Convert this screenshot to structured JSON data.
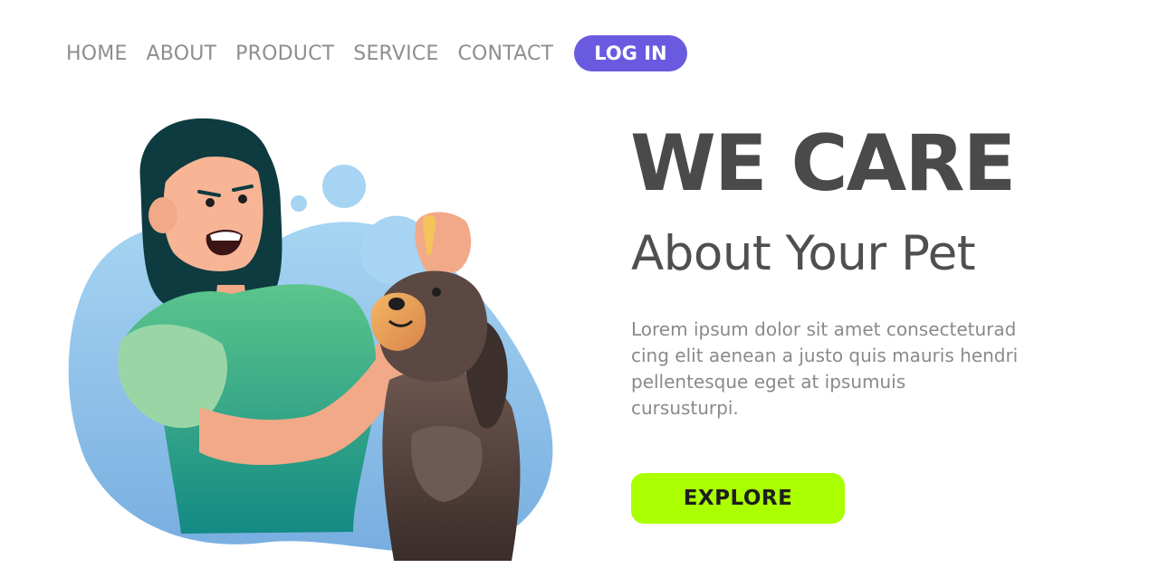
{
  "nav": {
    "items": [
      "HOME",
      "ABOUT",
      "PRODUCT",
      "SERVICE",
      "CONTACT"
    ],
    "login_label": "LOG IN"
  },
  "hero": {
    "headline": "WE CARE",
    "subheadline": "About Your Pet",
    "body_lines": [
      "Lorem ipsum dolor sit amet consecteturad",
      "cing elit aenean a justo quis mauris hendri",
      "pellentesque eget at ipsumuis",
      "cursusturpi."
    ],
    "cta_label": "EXPLORE"
  },
  "colors": {
    "login_bg": "#6a5ae0",
    "cta_bg": "#aaff00",
    "headline": "#4a4a4a",
    "nav_text": "#8e8e8e"
  }
}
